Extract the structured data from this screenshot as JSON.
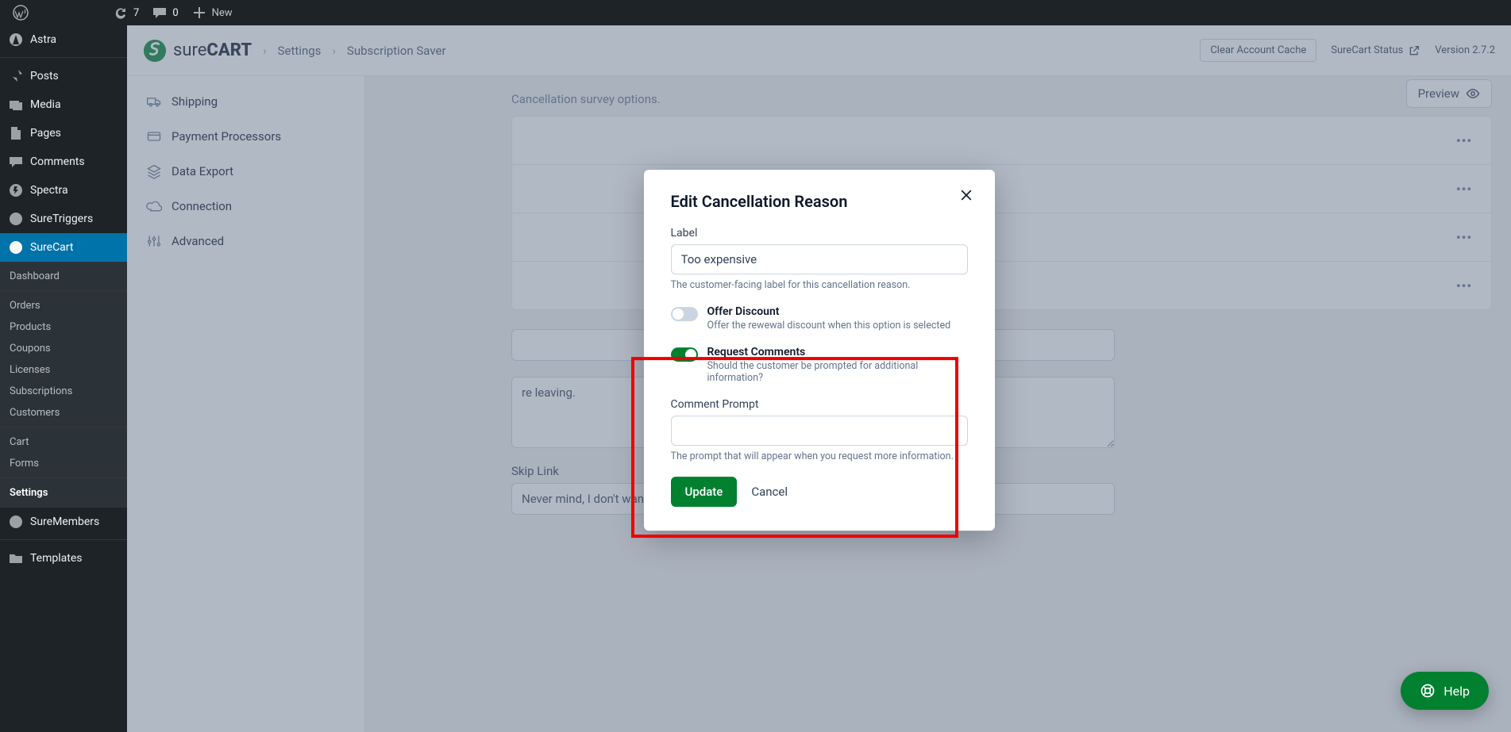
{
  "adminbar": {
    "updates_count": "7",
    "comments_count": "0",
    "new_label": "New"
  },
  "wp_menu": {
    "astra": "Astra",
    "posts": "Posts",
    "media": "Media",
    "pages": "Pages",
    "comments": "Comments",
    "spectra": "Spectra",
    "suretriggers": "SureTriggers",
    "surecart": "SureCart",
    "submenu": {
      "dashboard": "Dashboard",
      "orders": "Orders",
      "products": "Products",
      "coupons": "Coupons",
      "licenses": "Licenses",
      "subscriptions": "Subscriptions",
      "customers": "Customers",
      "cart": "Cart",
      "forms": "Forms",
      "settings": "Settings"
    },
    "suremembers": "SureMembers",
    "templates": "Templates"
  },
  "header": {
    "brand_sure": "sure",
    "brand_cart": "CART",
    "breadcrumb_1": "Settings",
    "breadcrumb_2": "Subscription Saver",
    "clear_cache": "Clear Account Cache",
    "status": "SureCart Status",
    "version": "Version 2.7.2"
  },
  "settings_nav": {
    "shipping": "Shipping",
    "payment_processors": "Payment Processors",
    "data_export": "Data Export",
    "connection": "Connection",
    "advanced": "Advanced"
  },
  "content": {
    "preview": "Preview",
    "desc": "Cancellation survey options.",
    "skip_link_label": "Skip Link",
    "skip_link_value": "Never mind, I don't want to cancel.",
    "leaving_textarea": "re leaving."
  },
  "modal": {
    "title": "Edit Cancellation Reason",
    "label_field": "Label",
    "label_value": "Too expensive",
    "label_help": "The customer-facing label for this cancellation reason.",
    "offer_discount_title": "Offer Discount",
    "offer_discount_desc": "Offer the rewewal discount when this option is selected",
    "request_comments_title": "Request Comments",
    "request_comments_desc": "Should the customer be prompted for additional information?",
    "comment_prompt_label": "Comment Prompt",
    "comment_prompt_help": "The prompt that will appear when you request more information.",
    "update_btn": "Update",
    "cancel_btn": "Cancel"
  },
  "help": {
    "label": "Help"
  }
}
